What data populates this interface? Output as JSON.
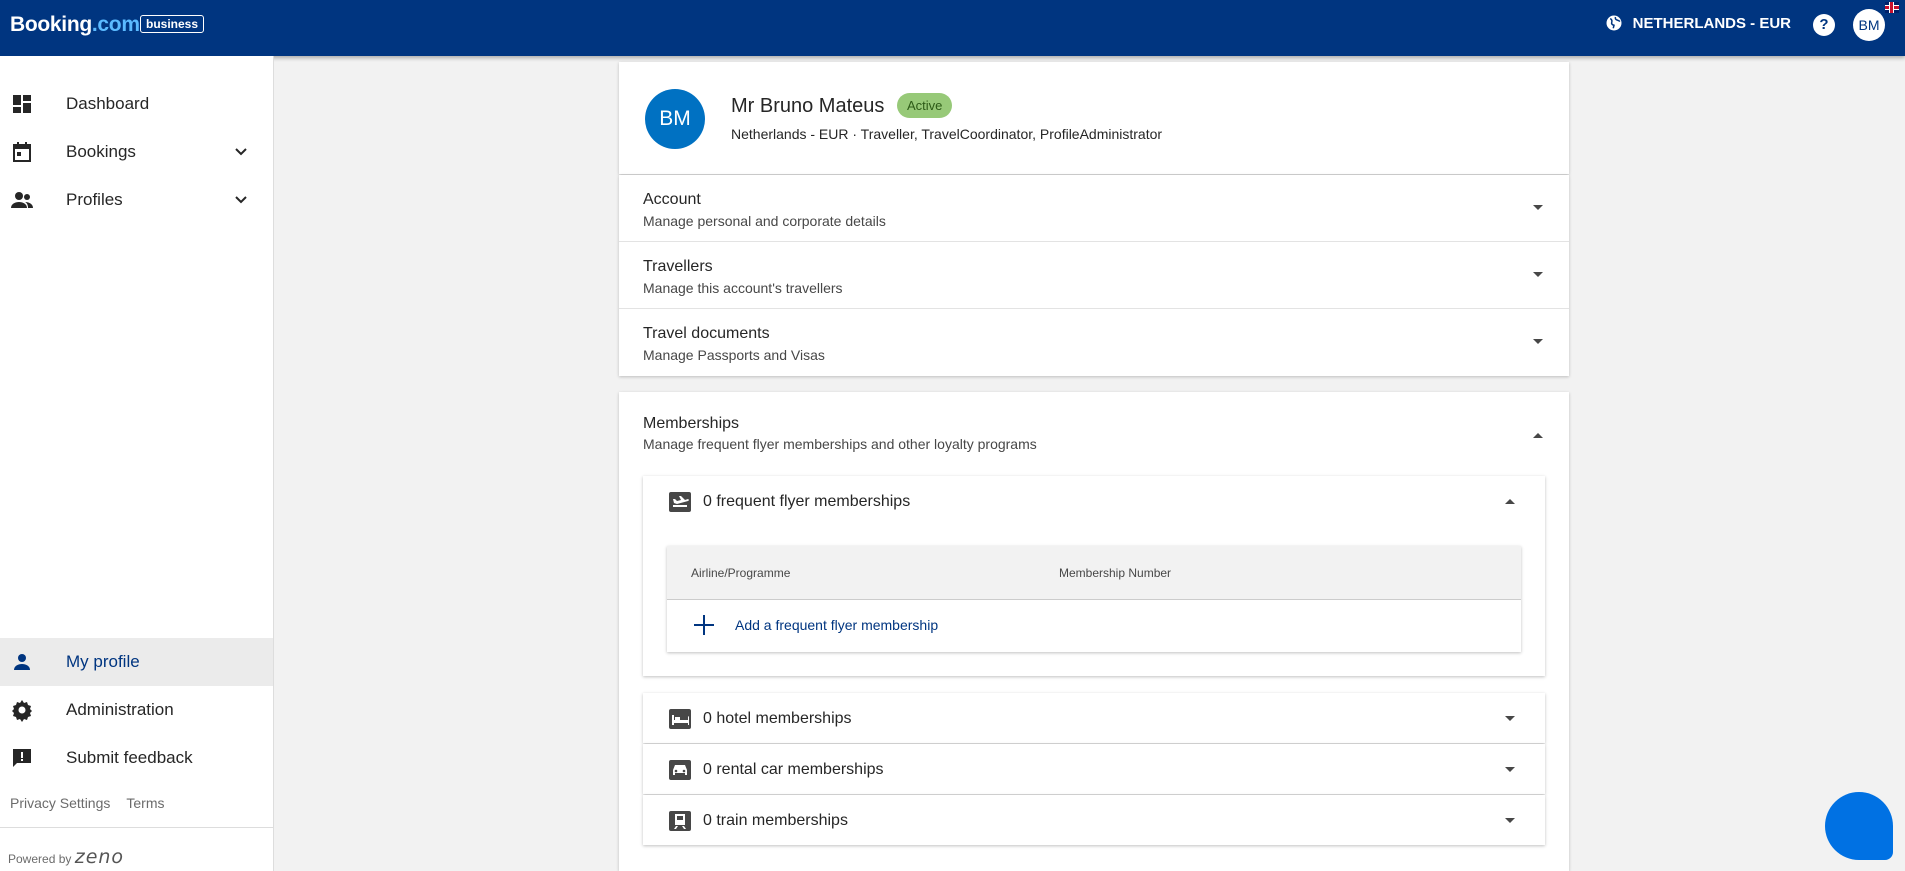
{
  "topbar": {
    "logo_main": "Booking",
    "logo_dot": ".com",
    "logo_badge": "business",
    "region_label": "NETHERLANDS - EUR",
    "help_label": "?",
    "avatar_initials": "BM"
  },
  "sidebar": {
    "items": [
      {
        "label": "Dashboard",
        "icon": "dashboard-icon"
      },
      {
        "label": "Bookings",
        "icon": "calendar-icon"
      },
      {
        "label": "Profiles",
        "icon": "people-icon"
      }
    ],
    "bottom_items": [
      {
        "label": "My profile",
        "icon": "person-icon"
      },
      {
        "label": "Administration",
        "icon": "gear-icon"
      },
      {
        "label": "Submit feedback",
        "icon": "feedback-icon"
      }
    ],
    "footer": {
      "privacy": "Privacy Settings",
      "terms": "Terms"
    },
    "powered_by": "Powered by",
    "powered_brand": "zeno"
  },
  "profile": {
    "initials": "BM",
    "name": "Mr Bruno Mateus",
    "status": "Active",
    "subtitle": "Netherlands - EUR · Traveller, TravelCoordinator, ProfileAdministrator"
  },
  "panels": [
    {
      "title": "Account",
      "description": "Manage personal and corporate details"
    },
    {
      "title": "Travellers",
      "description": "Manage this account's travellers"
    },
    {
      "title": "Travel documents",
      "description": "Manage Passports and Visas"
    }
  ],
  "memberships": {
    "title": "Memberships",
    "description": "Manage frequent flyer memberships and other loyalty programs",
    "frequent_flyer": {
      "title": "0 frequent flyer memberships",
      "columns": [
        "Airline/Programme",
        "Membership Number"
      ],
      "add_label": "Add a frequent flyer membership"
    },
    "others": [
      {
        "title": "0 hotel memberships",
        "icon": "bed-icon"
      },
      {
        "title": "0 rental car memberships",
        "icon": "car-icon"
      },
      {
        "title": "0 train memberships",
        "icon": "train-icon"
      }
    ]
  },
  "colors": {
    "brand": "#003580",
    "accent": "#0071c2",
    "status_active": "#97c978",
    "chat": "#0071e3"
  }
}
